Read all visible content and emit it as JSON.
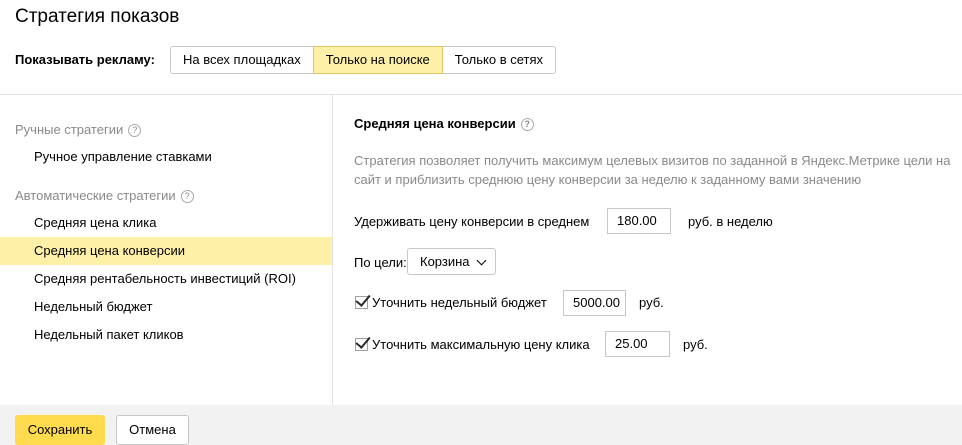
{
  "header": {
    "title": "Стратегия показов"
  },
  "show_ads": {
    "label": "Показывать рекламу:",
    "options": [
      "На всех площадках",
      "Только на поиске",
      "Только в сетях"
    ],
    "selected": "Только на поиске"
  },
  "sidebar": {
    "manual_group": "Ручные стратегии",
    "manual_items": [
      "Ручное управление ставками"
    ],
    "auto_group": "Автоматические стратегии",
    "auto_items": [
      "Средняя цена клика",
      "Средняя цена конверсии",
      "Средняя рентабельность инвестиций (ROI)",
      "Недельный бюджет",
      "Недельный пакет кликов"
    ],
    "selected": "Средняя цена конверсии",
    "help_glyph": "?"
  },
  "strategy": {
    "title": "Средняя цена конверсии",
    "description": "Стратегия позволяет получить максимум целевых визитов по заданной в Яндекс.Метрике цели на сайт и приблизить среднюю цену конверсии за неделю к заданному вами значению",
    "avg_price": {
      "label": "Удерживать цену конверсии в среднем",
      "value": "180.00",
      "unit": "руб. в неделю"
    },
    "goal": {
      "label": "По цели:",
      "value": "Корзина"
    },
    "weekly_budget": {
      "label": "Уточнить недельный бюджет",
      "checked": true,
      "value": "5000.00",
      "unit": "руб."
    },
    "max_click": {
      "label": "Уточнить максимальную цену клика",
      "checked": true,
      "value": "25.00",
      "unit": "руб."
    }
  },
  "footer": {
    "save_label": "Сохранить",
    "cancel_label": "Отмена"
  },
  "colors": {
    "accent_yellow": "#ffdb4d",
    "selected_bg": "#fff0a8",
    "muted_text": "#8a8a8a"
  }
}
